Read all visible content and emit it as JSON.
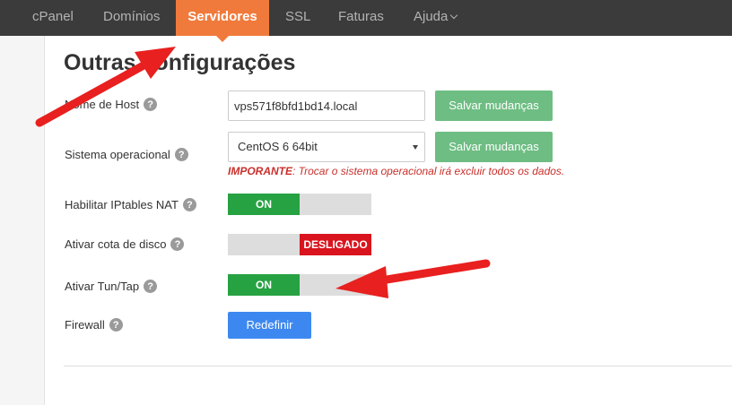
{
  "nav": {
    "items": [
      {
        "label": "cPanel",
        "active": false
      },
      {
        "label": "Domínios",
        "active": false
      },
      {
        "label": "Servidores",
        "active": true
      },
      {
        "label": "SSL",
        "active": false
      },
      {
        "label": "Faturas",
        "active": false
      },
      {
        "label": "Ajuda",
        "active": false,
        "dropdown": true
      }
    ]
  },
  "page": {
    "title": "Outras configurações"
  },
  "form": {
    "hostname": {
      "label": "Nome de Host",
      "value": "vps571f8bfd1bd14.local",
      "save_label": "Salvar mudanças"
    },
    "os": {
      "label": "Sistema operacional",
      "selected": "CentOS 6 64bit",
      "save_label": "Salvar mudanças",
      "warning_strong": "IMPORANTE",
      "warning_text": ": Trocar o sistema operacional irá excluir todos os dados."
    },
    "iptables": {
      "label": "Habilitar IPtables NAT",
      "state": "ON"
    },
    "quota": {
      "label": "Ativar cota de disco",
      "state": "DESLIGADO"
    },
    "tuntap": {
      "label": "Ativar Tun/Tap",
      "state": "ON"
    },
    "firewall": {
      "label": "Firewall",
      "button_label": "Redefinir"
    }
  },
  "icons": {
    "help": "?",
    "help_icon": "question-circle-icon"
  },
  "colors": {
    "nav_bg": "#3b3b3b",
    "nav_active": "#f07a3c",
    "btn_green": "#6ebd83",
    "toggle_on": "#27a243",
    "toggle_off": "#d9141e",
    "btn_blue": "#3d88f0",
    "warning": "#c9302c",
    "annotation_arrow": "#e8201f"
  }
}
